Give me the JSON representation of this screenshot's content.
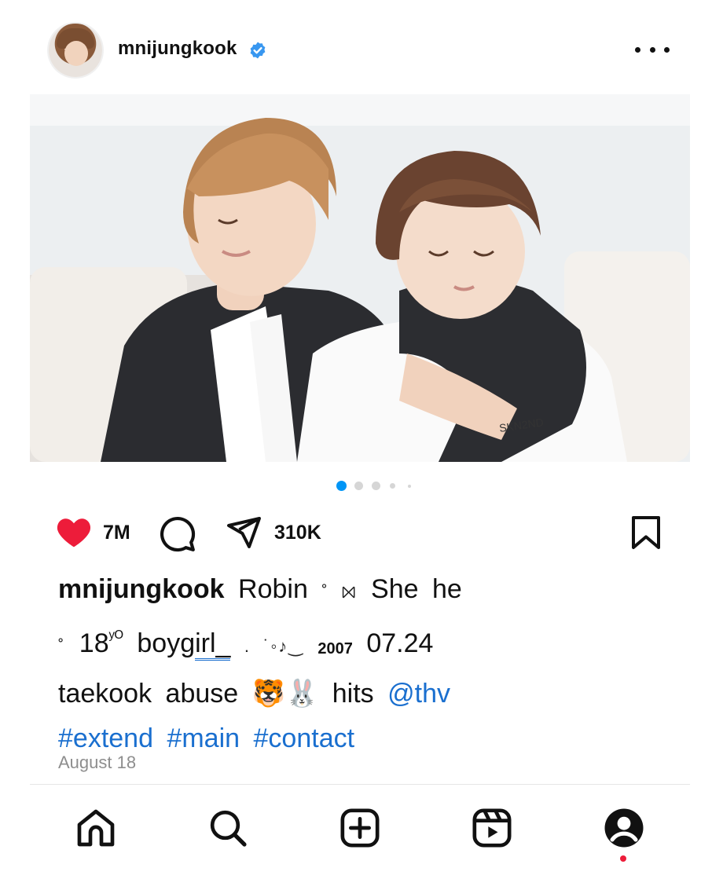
{
  "post": {
    "username": "mnijungkook",
    "verified": true,
    "carousel": {
      "total": 5,
      "active": 1
    },
    "likes": "7M",
    "shares": "310K",
    "date": "August 18"
  },
  "caption": {
    "username": "mnijungkook",
    "w1": "Robin",
    "g1": "˚ ⨝",
    "w2": "She",
    "w3": "he",
    "g2": "˚",
    "age": "18",
    "age_sup": "ʸᴼ",
    "w4_plain": "boyg",
    "w4_link": "irl_",
    "g3": ". ˙◦♪‿",
    "year": "2007",
    "date_code": "07.24",
    "w5": "taekook",
    "w6": "abuse",
    "emoji": "🐯🐰",
    "w7": "hits",
    "mention": "@thv",
    "tags": [
      "#extend",
      "#main",
      "#contact"
    ]
  },
  "colors": {
    "accent_link": "#1a6fcf",
    "like_red": "#ed1c3a",
    "verified_blue": "#3897f0",
    "dot_active": "#0095f6"
  },
  "icons": {
    "header": [
      "verified-badge-icon",
      "more-options-icon"
    ],
    "actions": [
      "heart-icon",
      "comment-icon",
      "share-icon",
      "bookmark-icon"
    ],
    "nav": [
      "home-icon",
      "search-icon",
      "create-icon",
      "reels-icon",
      "profile-icon"
    ]
  }
}
